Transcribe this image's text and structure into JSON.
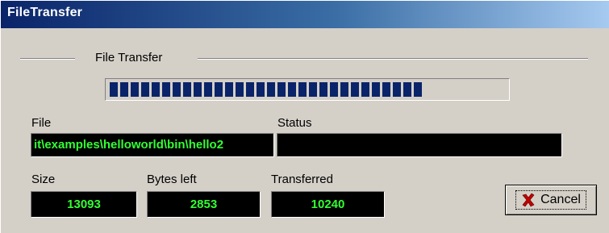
{
  "window": {
    "title": "FileTransfer"
  },
  "group": {
    "title": "File Transfer"
  },
  "progress": {
    "fraction": 0.8045,
    "color": "#0a246a"
  },
  "fields": {
    "file_label": "File",
    "file_value": "it\\examples\\helloworld\\bin\\hello2",
    "status_label": "Status",
    "status_value": "",
    "size_label": "Size",
    "size_value": "13093",
    "bytes_left_label": "Bytes left",
    "bytes_left_value": "2853",
    "transferred_label": "Transferred",
    "transferred_value": "10240"
  },
  "buttons": {
    "cancel_label": "Cancel",
    "cancel_icon": "x-icon"
  },
  "colors": {
    "lcd_background": "#000000",
    "lcd_text": "#33ff33",
    "titlebar_start": "#0a246a",
    "titlebar_end": "#a6caf0"
  }
}
